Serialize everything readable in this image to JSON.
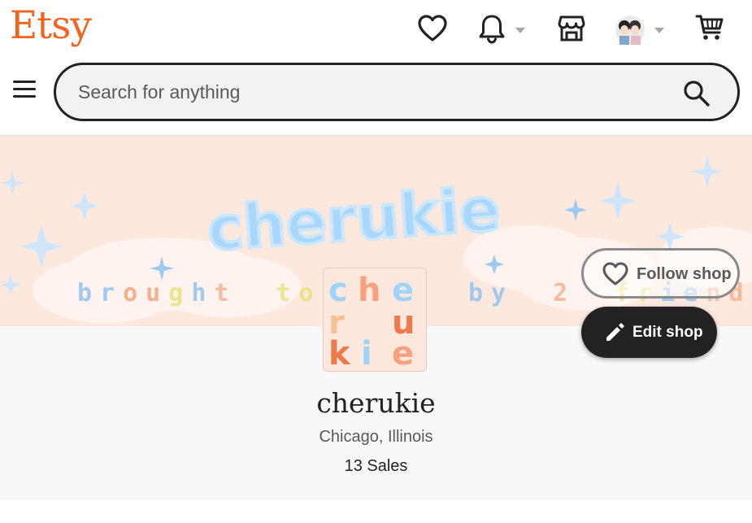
{
  "header": {
    "logo": "Etsy",
    "icons": {
      "favorites": "heart-icon",
      "notifications": "bell-icon",
      "shop_manager": "storefront-icon",
      "account": "avatar",
      "cart": "cart-icon"
    }
  },
  "search": {
    "placeholder": "Search for anything"
  },
  "banner": {
    "title_art": "cherukie",
    "tagline_art": "brought to you by 2 friends!!!"
  },
  "shop": {
    "name": "cherukie",
    "location": "Chicago, Illinois",
    "sales": "13 Sales",
    "logo_letters": [
      "c",
      "h",
      "e",
      "r",
      "u",
      "k",
      "i",
      "e"
    ]
  },
  "actions": {
    "follow_label": "Follow shop",
    "edit_label": "Edit shop"
  },
  "colors": {
    "brand": "#f1641e",
    "banner_bg": "#fde8de",
    "text": "#222222",
    "muted": "#595959"
  }
}
